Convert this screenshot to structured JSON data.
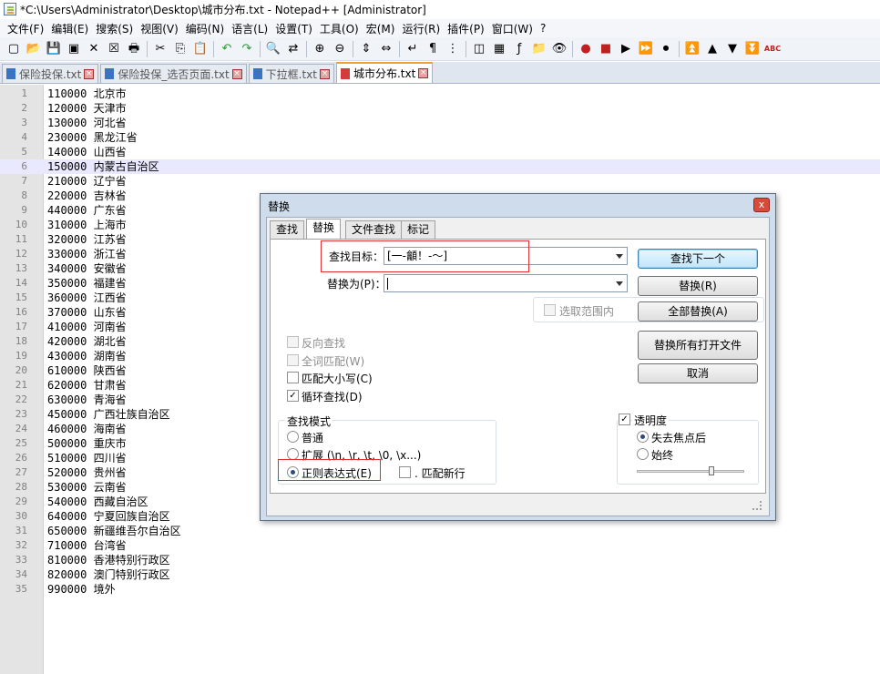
{
  "window": {
    "title": "*C:\\Users\\Administrator\\Desktop\\城市分布.txt - Notepad++ [Administrator]"
  },
  "menu": [
    "文件(F)",
    "编辑(E)",
    "搜索(S)",
    "视图(V)",
    "编码(N)",
    "语言(L)",
    "设置(T)",
    "工具(O)",
    "宏(M)",
    "运行(R)",
    "插件(P)",
    "窗口(W)",
    "?"
  ],
  "toolbar": {
    "icons": [
      "new-file-icon",
      "open-file-icon",
      "save-icon",
      "save-all-icon",
      "close-icon",
      "close-all-icon",
      "print-icon",
      "sep",
      "cut-icon",
      "copy-icon",
      "paste-icon",
      "sep",
      "undo-icon",
      "redo-icon",
      "sep",
      "find-icon",
      "replace-icon",
      "sep",
      "zoom-in-icon",
      "zoom-out-icon",
      "sep",
      "sync-v-icon",
      "sync-h-icon",
      "sep",
      "wrap-icon",
      "all-chars-icon",
      "indent-guide-icon",
      "sep",
      "lang-icon",
      "doc-map-icon",
      "function-list-icon",
      "folder-icon",
      "monitor-icon",
      "sep",
      "record-icon",
      "stop-icon",
      "play-icon",
      "play-multi-icon",
      "save-macro-icon",
      "sep",
      "collapse-icon",
      "up-icon",
      "down-icon",
      "expand-icon",
      "spellcheck-icon"
    ],
    "glyphs": [
      "▢",
      "📂",
      "💾",
      "▣",
      "✕",
      "☒",
      "🖶",
      "",
      "✂",
      "⎘",
      "📋",
      "",
      "↶",
      "↷",
      "",
      "🔍",
      "⇄",
      "",
      "⊕",
      "⊖",
      "",
      "⇕",
      "⇔",
      "",
      "↵",
      "¶",
      "⋮",
      "",
      "◫",
      "▦",
      "ƒ",
      "📁",
      "👁",
      "",
      "●",
      "■",
      "▶",
      "⏩",
      "⏺",
      "",
      "⏫",
      "▲",
      "▼",
      "⏬",
      "ABC"
    ]
  },
  "tabs": [
    {
      "label": "保险投保.txt",
      "active": false
    },
    {
      "label": "保险投保_选否页面.txt",
      "active": false
    },
    {
      "label": "下拉框.txt",
      "active": false
    },
    {
      "label": "城市分布.txt",
      "active": true
    }
  ],
  "editor": {
    "current_line": 6,
    "lines": [
      {
        "num": "1",
        "text": "110000 北京市"
      },
      {
        "num": "2",
        "text": "120000 天津市"
      },
      {
        "num": "3",
        "text": "130000 河北省"
      },
      {
        "num": "4",
        "text": "230000 黑龙江省"
      },
      {
        "num": "5",
        "text": "140000 山西省"
      },
      {
        "num": "6",
        "text": "150000 内蒙古自治区"
      },
      {
        "num": "7",
        "text": "210000 辽宁省"
      },
      {
        "num": "8",
        "text": "220000 吉林省"
      },
      {
        "num": "9",
        "text": "440000 广东省"
      },
      {
        "num": "10",
        "text": "310000 上海市"
      },
      {
        "num": "11",
        "text": "320000 江苏省"
      },
      {
        "num": "12",
        "text": "330000 浙江省"
      },
      {
        "num": "13",
        "text": "340000 安徽省"
      },
      {
        "num": "14",
        "text": "350000 福建省"
      },
      {
        "num": "15",
        "text": "360000 江西省"
      },
      {
        "num": "16",
        "text": "370000 山东省"
      },
      {
        "num": "17",
        "text": "410000 河南省"
      },
      {
        "num": "18",
        "text": "420000 湖北省"
      },
      {
        "num": "19",
        "text": "430000 湖南省"
      },
      {
        "num": "20",
        "text": "610000 陕西省"
      },
      {
        "num": "21",
        "text": "620000 甘肃省"
      },
      {
        "num": "22",
        "text": "630000 青海省"
      },
      {
        "num": "23",
        "text": "450000 广西壮族自治区"
      },
      {
        "num": "24",
        "text": "460000 海南省"
      },
      {
        "num": "25",
        "text": "500000 重庆市"
      },
      {
        "num": "26",
        "text": "510000 四川省"
      },
      {
        "num": "27",
        "text": "520000 贵州省"
      },
      {
        "num": "28",
        "text": "530000 云南省"
      },
      {
        "num": "29",
        "text": "540000 西藏自治区"
      },
      {
        "num": "30",
        "text": "640000 宁夏回族自治区"
      },
      {
        "num": "31",
        "text": "650000 新疆维吾尔自治区"
      },
      {
        "num": "32",
        "text": "710000 台湾省"
      },
      {
        "num": "33",
        "text": "810000 香港特别行政区"
      },
      {
        "num": "34",
        "text": "820000 澳门特别行政区"
      },
      {
        "num": "35",
        "text": "990000 境外"
      }
    ]
  },
  "dialog": {
    "title": "替换",
    "close": "x",
    "tabs": [
      "查找",
      "替换",
      "文件查找",
      "标记"
    ],
    "find_label": "查找目标：",
    "find_value": "[一-龥！-～]",
    "replace_label": "替换为(P)：",
    "replace_value": "",
    "in_selection": "选取范围内",
    "options": {
      "reverse": "反向查找",
      "whole_word": "全词匹配(W)",
      "match_case": "匹配大小写(C)",
      "wrap": "循环查找(D)"
    },
    "search_mode": {
      "title": "查找模式",
      "normal": "普通",
      "extended": "扩展 (\\n, \\r, \\t, \\0, \\x...)",
      "regex": "正则表达式(E)",
      "dot_newline": ". 匹配新行"
    },
    "transparency": {
      "title": "透明度",
      "on_lose_focus": "失去焦点后",
      "always": "始终",
      "level": 0.72
    },
    "buttons": {
      "find_next": "查找下一个",
      "replace": "替换(R)",
      "replace_all": "全部替换(A)",
      "replace_all_open": "替换所有打开文件",
      "cancel": "取消"
    }
  }
}
